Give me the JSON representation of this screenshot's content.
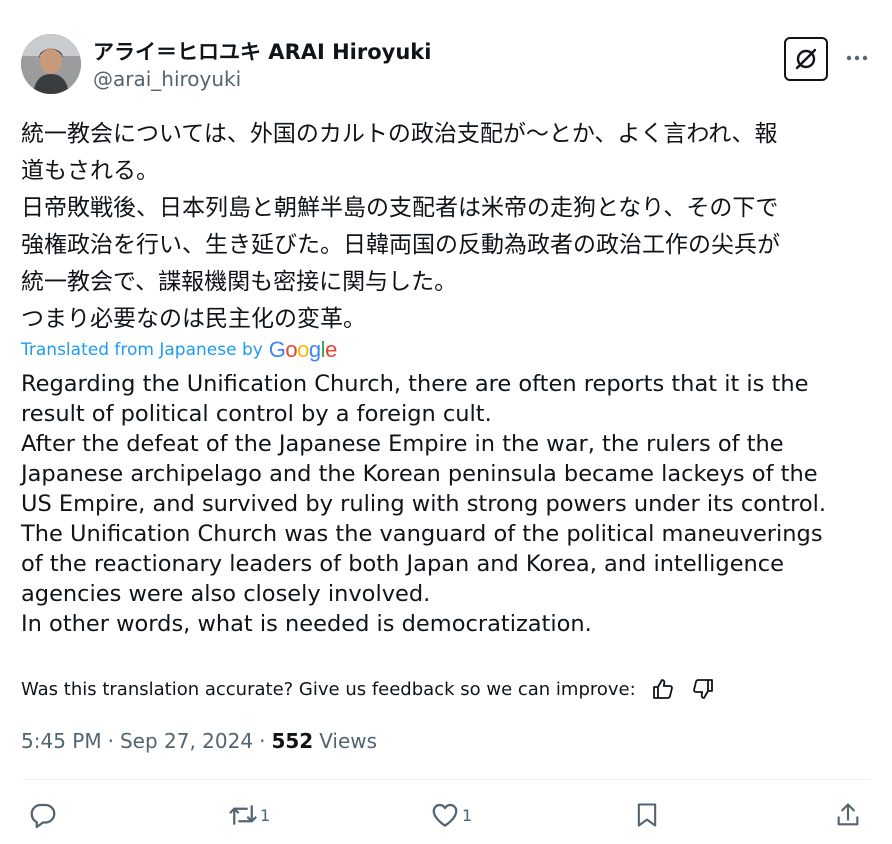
{
  "author": {
    "display_name": "アライ＝ヒロユキ ARAI Hiroyuki",
    "handle": "@arai_hiroyuki"
  },
  "tweet": {
    "original_lines": [
      "統一教会については、外国のカルトの政治支配が〜とか、よく言われ、報",
      "道もされる。",
      "日帝敗戦後、日本列島と朝鮮半島の支配者は米帝の走狗となり、その下で",
      "強権政治を行い、生き延びた。日韓両国の反動為政者の政治工作の尖兵が",
      "統一教会で、諜報機関も密接に関与した。",
      "つまり必要なのは民主化の変革。"
    ],
    "translated_label": "Translated from Japanese by",
    "translator": "Google",
    "translation_lines": [
      "Regarding the Unification Church, there are often reports that it is the",
      "result of political control by a foreign cult.",
      "After the defeat of the Japanese Empire in the war, the rulers of the",
      "Japanese archipelago and the Korean peninsula became lackeys of the",
      "US Empire, and survived by ruling with strong powers under its control.",
      "The Unification Church was the vanguard of the political maneuverings",
      "of the reactionary leaders of both Japan and Korea, and intelligence",
      "agencies were also closely involved.",
      "In other words, what is needed is democratization."
    ],
    "feedback_prompt": "Was this translation accurate? Give us feedback so we can improve:",
    "time": "5:45 PM",
    "separator": "·",
    "date": "Sep 27, 2024",
    "views_count": "552",
    "views_label": "Views"
  },
  "actions": {
    "reply_count": "",
    "retweet_count": "1",
    "like_count": "1"
  },
  "icons": {
    "grok": "grok-icon",
    "more": "more-icon",
    "thumbs_up": "thumbs-up-icon",
    "thumbs_down": "thumbs-down-icon",
    "reply": "reply-icon",
    "retweet": "retweet-icon",
    "like": "heart-icon",
    "bookmark": "bookmark-icon",
    "share": "share-icon"
  },
  "colors": {
    "text": "#0f1419",
    "secondary": "#536471",
    "link": "#1d9bf0",
    "divider": "#eff3f4"
  }
}
